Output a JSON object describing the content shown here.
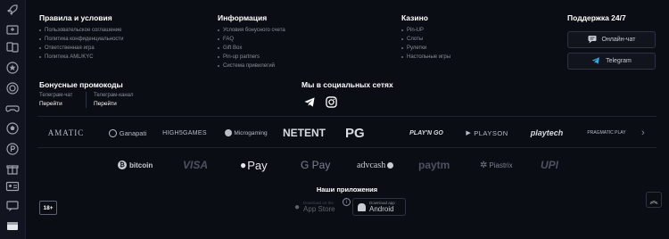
{
  "sidebar": {
    "icons": [
      "rocket-icon",
      "ticket-icon",
      "dice-icon",
      "star-icon",
      "target-icon",
      "gamepad-icon",
      "soccer-ball-icon",
      "pinup-icon",
      "gift-icon",
      "id-card-icon",
      "chat-support-icon",
      "wallet-icon"
    ]
  },
  "footer": {
    "terms": {
      "title": "Правила и условия",
      "items": [
        "Пользовательское соглашение",
        "Политика конфиденциальности",
        "Ответственная игра",
        "Политика AML/KYC"
      ]
    },
    "info": {
      "title": "Информация",
      "items": [
        "Условия бонусного счета",
        "FAQ",
        "Gift Box",
        "Pin-up partners",
        "Система привилегий"
      ]
    },
    "casino": {
      "title": "Казино",
      "items": [
        "Pin-UP",
        "Слоты",
        "Рулетки",
        "Настольные игры"
      ]
    },
    "support": {
      "title": "Поддержка 24/7",
      "chat_label": "Онлайн-чат",
      "telegram_label": "Telegram"
    },
    "promo": {
      "title": "Бонусные промокоды",
      "telegram_chat_label": "Телеграм-чат",
      "telegram_chat_link": "Перейти",
      "telegram_channel_label": "Телеграм-канал",
      "telegram_channel_link": "Перейти"
    },
    "social": {
      "title": "Мы в социальных сетях"
    },
    "providers": [
      "AMATIC",
      "Ganapati",
      "HIGH5GAMES",
      "Microgaming",
      "NETENT",
      "PG",
      "PLAY'N GO",
      "PLAYSON",
      "playtech",
      "PRAGMATIC PLAY"
    ],
    "payments": [
      "bitcoin",
      "VISA",
      "Pay",
      "G Pay",
      "advcash",
      "paytm",
      "Piastrix",
      "UPI"
    ],
    "apps": {
      "title": "Наши приложения",
      "appstore_small": "Download on the",
      "appstore_big": "App Store",
      "android_small": "Download app",
      "android_big": "Android"
    },
    "age_badge": "18+",
    "scroll_top": "︽"
  }
}
